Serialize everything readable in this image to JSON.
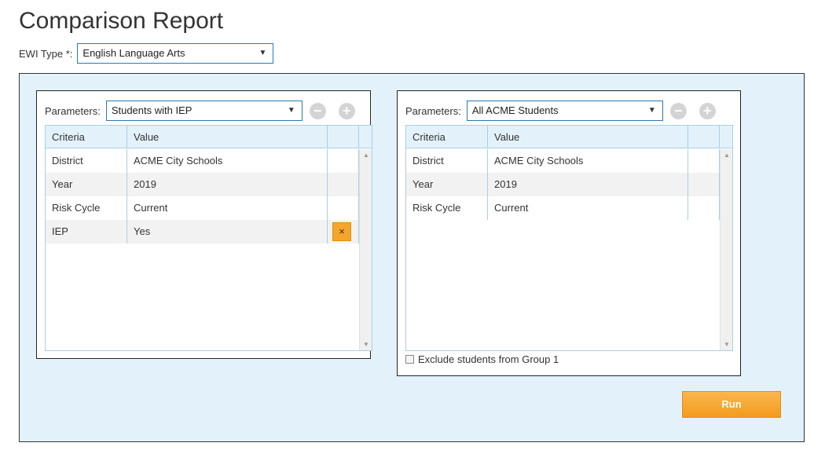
{
  "page": {
    "title": "Comparison Report"
  },
  "ewi": {
    "label": "EWI Type *:",
    "value": "English Language Arts"
  },
  "group1": {
    "params_label": "Parameters:",
    "params_value": "Students with IEP",
    "columns": {
      "criteria": "Criteria",
      "value": "Value"
    },
    "rows": [
      {
        "criteria": "District",
        "value": "ACME City Schools"
      },
      {
        "criteria": "Year",
        "value": "2019"
      },
      {
        "criteria": "Risk Cycle",
        "value": "Current"
      },
      {
        "criteria": "IEP",
        "value": "Yes",
        "remove_icon": "×"
      }
    ]
  },
  "group2": {
    "params_label": "Parameters:",
    "params_value": "All ACME Students",
    "columns": {
      "criteria": "Criteria",
      "value": "Value"
    },
    "rows": [
      {
        "criteria": "District",
        "value": "ACME City Schools"
      },
      {
        "criteria": "Year",
        "value": "2019"
      },
      {
        "criteria": "Risk Cycle",
        "value": "Current"
      }
    ],
    "exclude_label": "Exclude students from Group 1",
    "exclude_checked": false
  },
  "actions": {
    "run_label": "Run"
  },
  "icons": {
    "caret": "▼",
    "minus": "−",
    "plus": "+",
    "scroll_up": "▲",
    "scroll_down": "▼"
  },
  "colors": {
    "accent_blue": "#2a7ab0",
    "panel_bg": "#e3f2fa",
    "orange": "#f5a52a",
    "disabled_circle": "#d4d4d4"
  }
}
